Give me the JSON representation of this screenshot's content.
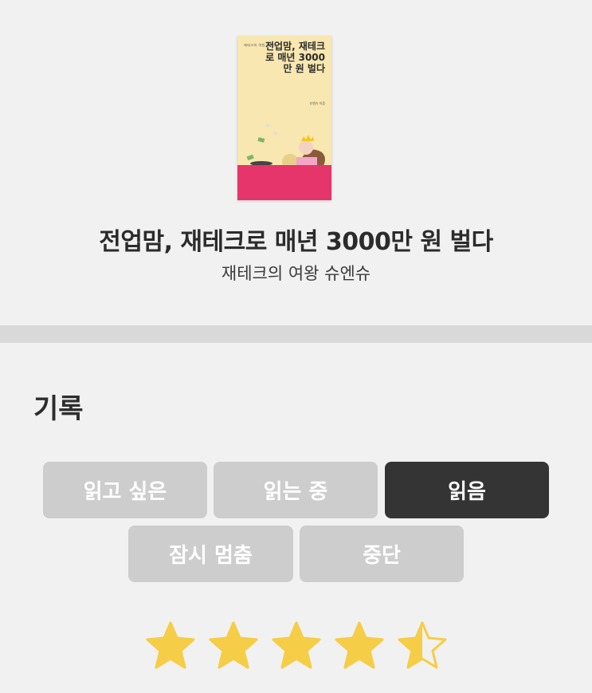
{
  "book": {
    "title": "전업맘, 재테크로 매년 3000만 원 벌다",
    "author": "재테크의 여왕 슈엔슈",
    "cover": {
      "tagline": "재테크의 여왕 슈엔슈",
      "title": "전업맘, 재테크로 매년 3000만 원 벌다",
      "author": "슈엔슈 지음"
    }
  },
  "record": {
    "section_title": "기록",
    "statuses": [
      {
        "label": "읽고 싶은",
        "selected": false
      },
      {
        "label": "읽는 중",
        "selected": false
      },
      {
        "label": "읽음",
        "selected": true
      },
      {
        "label": "잠시 멈춤",
        "selected": false
      },
      {
        "label": "중단",
        "selected": false
      }
    ]
  },
  "rating": {
    "value": 4.5,
    "max": 5
  },
  "colors": {
    "star": "#f5cd47",
    "selected_button": "#343434",
    "button": "#cdcdcd",
    "cover_band": "#e5356a"
  }
}
